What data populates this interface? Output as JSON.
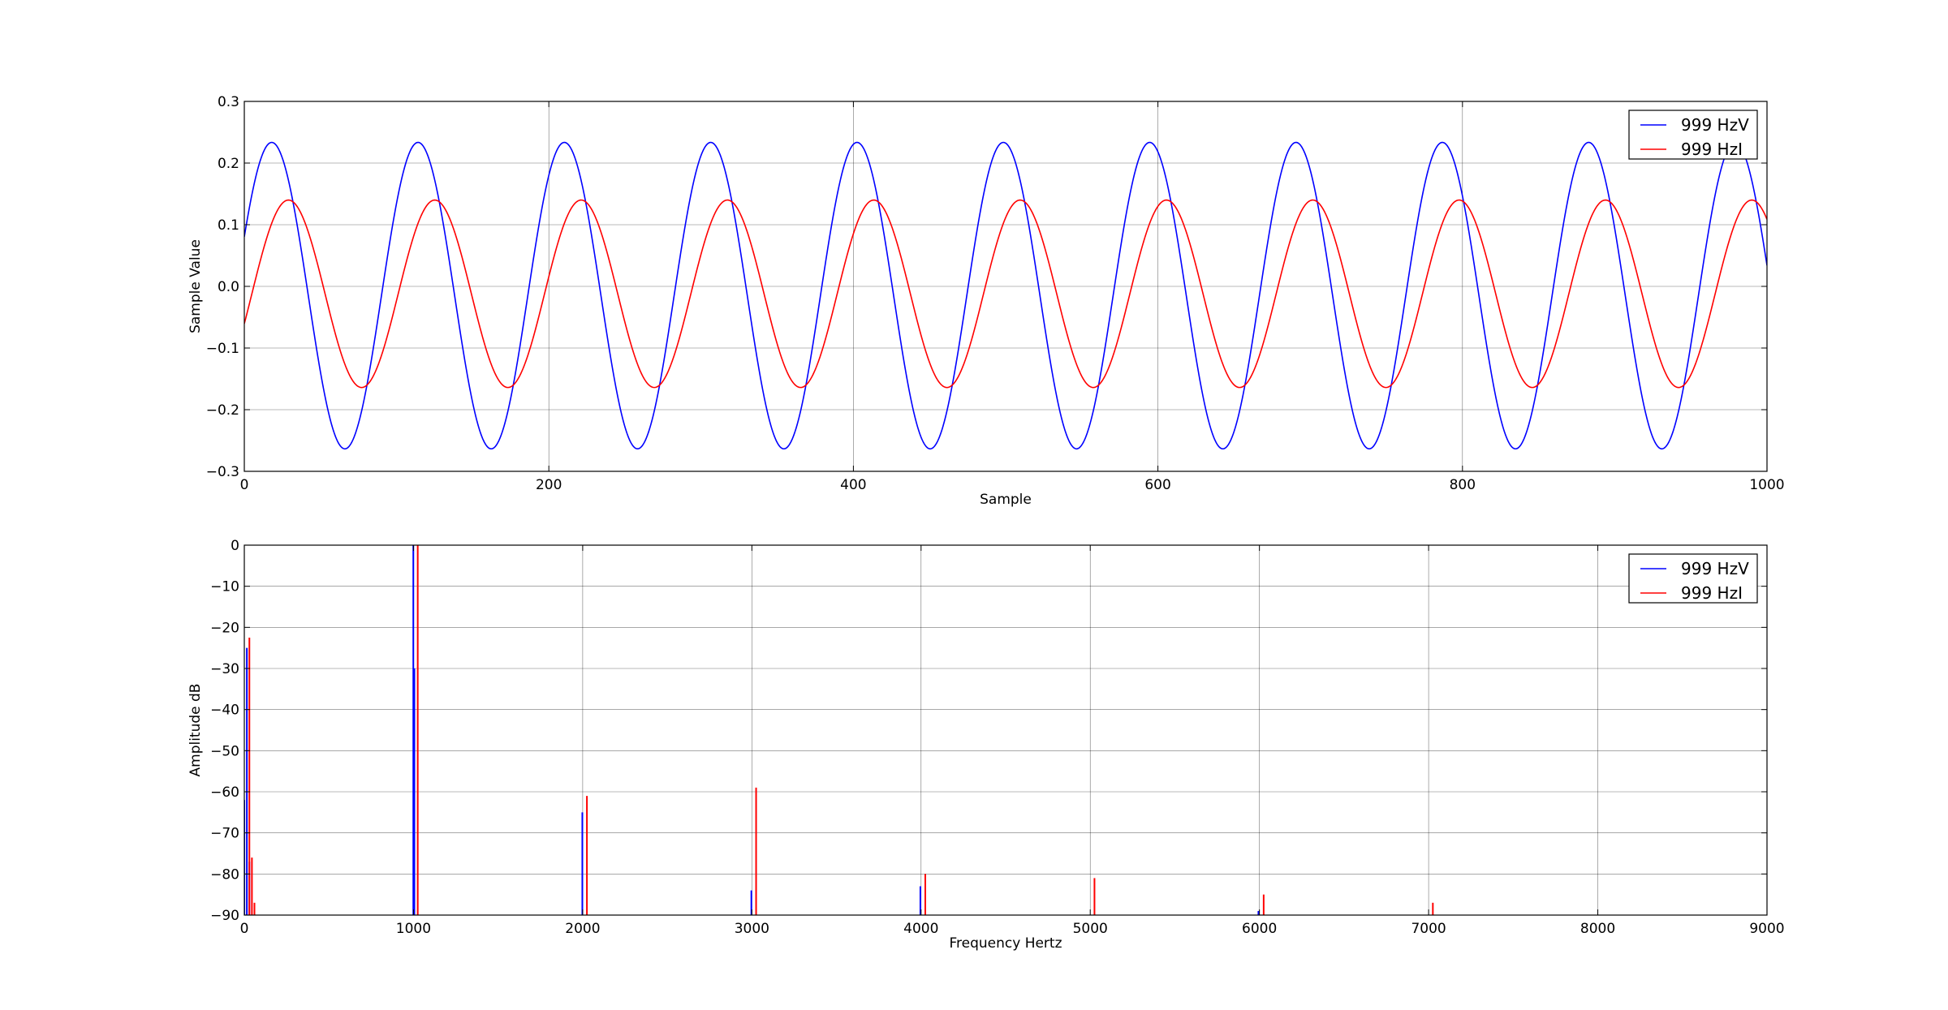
{
  "chart_data": [
    {
      "type": "line",
      "xlabel": "Sample",
      "ylabel": "Sample Value",
      "xlim": [
        0,
        1000
      ],
      "ylim": [
        -0.3,
        0.3
      ],
      "xticks": [
        0,
        200,
        400,
        600,
        800,
        1000
      ],
      "xtick_labels": [
        "0",
        "200",
        "400",
        "600",
        "800",
        "1000"
      ],
      "yticks": [
        -0.3,
        -0.2,
        -0.1,
        0.0,
        0.1,
        0.2,
        0.3
      ],
      "ytick_labels": [
        "−0.3",
        "−0.2",
        "−0.1",
        "0.0",
        "0.1",
        "0.2",
        "0.3"
      ],
      "grid": true,
      "legend_position": "top-right",
      "series": [
        {
          "name": "999 HzV",
          "color": "#0000ff",
          "waveform": "sine",
          "amplitude": 0.2485,
          "offset": -0.015,
          "period_samples": 96.1,
          "first_peak_sample": 18,
          "y_at_0": 0.09,
          "y_at_1000": 0.02
        },
        {
          "name": "999 HzI",
          "color": "#ff0000",
          "waveform": "sine",
          "amplitude": 0.152,
          "offset": -0.012,
          "period_samples": 96.1,
          "first_peak_sample": 29,
          "y_at_0": -0.058,
          "y_at_1000": 0.105
        }
      ]
    },
    {
      "type": "bar",
      "style": "stem",
      "xlabel": "Frequency Hertz",
      "ylabel": "Amplitude dB",
      "xlim": [
        0,
        9000
      ],
      "ylim": [
        -90,
        0
      ],
      "xticks": [
        0,
        1000,
        2000,
        3000,
        4000,
        5000,
        6000,
        7000,
        8000,
        9000
      ],
      "xtick_labels": [
        "0",
        "1000",
        "2000",
        "3000",
        "4000",
        "5000",
        "6000",
        "7000",
        "8000",
        "9000"
      ],
      "yticks": [
        -90,
        -80,
        -70,
        -60,
        -50,
        -40,
        -30,
        -20,
        -10,
        0
      ],
      "ytick_labels": [
        "−90",
        "−80",
        "−70",
        "−60",
        "−50",
        "−40",
        "−30",
        "−20",
        "−10",
        "0"
      ],
      "grid": true,
      "legend_position": "top-right",
      "series": [
        {
          "name": "999 HzV",
          "color": "#0000ff",
          "points": [
            {
              "x": 0,
              "y": -62
            },
            {
              "x": 15,
              "y": -25
            },
            {
              "x": 30,
              "y": -77
            },
            {
              "x": 999,
              "y": 0
            },
            {
              "x": 1005,
              "y": -30
            },
            {
              "x": 1998,
              "y": -65
            },
            {
              "x": 2997,
              "y": -84
            },
            {
              "x": 3996,
              "y": -83
            },
            {
              "x": 5994,
              "y": -89
            }
          ]
        },
        {
          "name": "999 HzI",
          "color": "#ff0000",
          "points": [
            {
              "x": 30,
              "y": -22.5
            },
            {
              "x": 45,
              "y": -76
            },
            {
              "x": 60,
              "y": -87
            },
            {
              "x": 1025,
              "y": 0
            },
            {
              "x": 2025,
              "y": -61
            },
            {
              "x": 3025,
              "y": -59
            },
            {
              "x": 4025,
              "y": -80
            },
            {
              "x": 5025,
              "y": -81
            },
            {
              "x": 6025,
              "y": -85
            },
            {
              "x": 7025,
              "y": -87
            }
          ]
        }
      ]
    }
  ]
}
